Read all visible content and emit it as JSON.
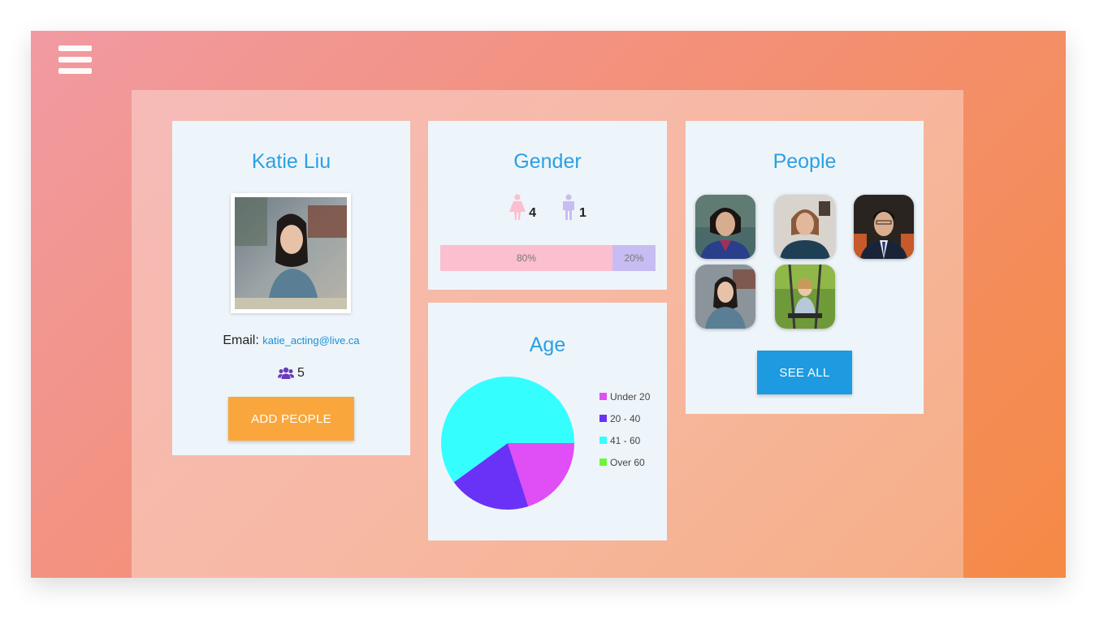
{
  "nav": {
    "menu_icon": "hamburger-menu-icon"
  },
  "profile": {
    "name": "Katie Liu",
    "email_label": "Email:",
    "email": "katie_acting@live.ca",
    "people_icon": "users-icon",
    "people_count": "5",
    "add_button": "ADD PEOPLE"
  },
  "gender": {
    "title": "Gender",
    "female_icon": "female-icon",
    "female_count": "4",
    "male_icon": "male-icon",
    "male_count": "1",
    "female_percent_label": "80%",
    "male_percent_label": "20%",
    "female_share": 0.8,
    "male_share": 0.2,
    "female_color": "#fbbfcf",
    "male_color": "#c8bdf2"
  },
  "age": {
    "title": "Age"
  },
  "chart_data": {
    "type": "pie",
    "categories": [
      "Under 20",
      "20 - 40",
      "41 - 60",
      "Over 60"
    ],
    "values": [
      1,
      1,
      3,
      0
    ],
    "colors": [
      "#e04ef5",
      "#6a32f7",
      "#35feff",
      "#6ef53a"
    ],
    "legend_position": "right"
  },
  "people": {
    "title": "People",
    "see_all_button": "SEE ALL"
  },
  "colors": {
    "accent_blue": "#2aa0e3",
    "button_orange": "#f9a73c",
    "button_blue": "#1e9ae0",
    "card_bg": "#eef5fa"
  }
}
